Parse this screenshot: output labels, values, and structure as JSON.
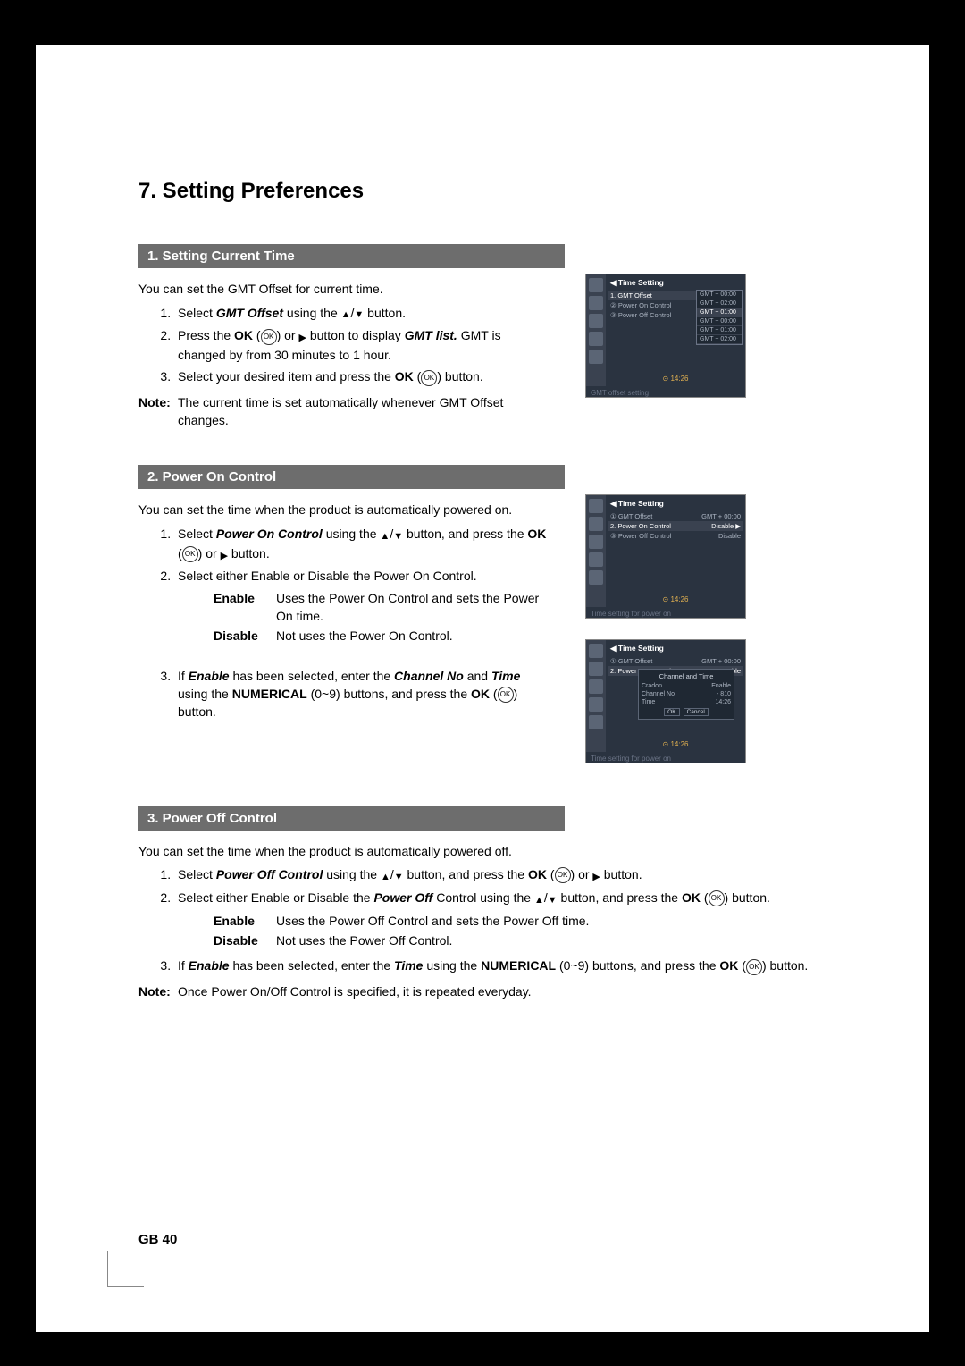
{
  "page": {
    "chapter_title": "7. Setting Preferences",
    "footer": "GB 40"
  },
  "s1": {
    "bar": "1. Setting Current Time",
    "intro": "You can set the GMT Offset for current time.",
    "step1_a": "Select ",
    "step1_b": "GMT Offset",
    "step1_c": " using the ",
    "step1_d": " button.",
    "step2_a": "Press the ",
    "step2_b": "OK",
    "step2_c": " button to display ",
    "step2_d": "GMT list.",
    "step2_e": " GMT is changed by from 30 minutes to 1 hour.",
    "step3_a": "Select your desired item and press the ",
    "step3_b": "OK",
    "step3_c": " button.",
    "note_label": "Note:",
    "note_body": "The current time is set automatically whenever GMT Offset changes."
  },
  "s2": {
    "bar": "2. Power On Control",
    "intro": "You can set the time when the product is automatically powered on.",
    "step1_a": "Select ",
    "step1_b": "Power On Control",
    "step1_c": " using the ",
    "step1_d": " button, and press the ",
    "step1_e": "OK",
    "step1_f": " button.",
    "step2": "Select either Enable or Disable the Power On Control.",
    "def_enable_t": "Enable",
    "def_enable_d": "Uses the Power On Control and sets the Power On time.",
    "def_disable_t": "Disable",
    "def_disable_d": "Not uses the Power On Control.",
    "step3_a": "If ",
    "step3_b": "Enable",
    "step3_c": " has been selected, enter the ",
    "step3_d": "Channel No",
    "step3_e": " and ",
    "step3_f": "Time",
    "step3_g": " using the ",
    "step3_h": "NUMERICAL",
    "step3_i": " (0~9) buttons, and press the ",
    "step3_j": "OK",
    "step3_k": " button."
  },
  "s3": {
    "bar": "3. Power Off Control",
    "intro": "You can set the time when the product is automatically powered off.",
    "step1_a": "Select ",
    "step1_b": "Power Off Control",
    "step1_c": " using the ",
    "step1_d": " button, and press the ",
    "step1_e": "OK",
    "step1_f": " button.",
    "step2_a": "Select either Enable or Disable the ",
    "step2_b": "Power Off",
    "step2_c": " Control using the ",
    "step2_d": " button, and press the ",
    "step2_e": "OK",
    "step2_f": " button.",
    "def_enable_t": "Enable",
    "def_enable_d": "Uses the Power Off Control and sets the Power Off time.",
    "def_disable_t": "Disable",
    "def_disable_d": "Not uses the Power Off Control.",
    "step3_a": "If ",
    "step3_b": "Enable",
    "step3_c": " has been selected, enter the ",
    "step3_d": "Time",
    "step3_e": " using the ",
    "step3_f": "NUMERICAL",
    "step3_g": " (0~9) buttons, and press the ",
    "step3_h": "OK",
    "step3_i": " button.",
    "note_label": "Note:",
    "note_body": "Once Power On/Off Control is specified, it is repeated everyday."
  },
  "shots": {
    "title": "Time Setting",
    "row_gmt": "GMT Offset",
    "row_pon": "Power On Control",
    "row_poff": "Power Off Control",
    "gmt_v": "GMT + 00:00",
    "dd1": "GMT + 00:00",
    "dd2": "GMT + 01:00",
    "dd3": "GMT + 01:00",
    "dd4": "GMT + 02:00",
    "dd5": "GMT + 02:00",
    "disable": "Disable",
    "disable_arrow": "Disable ▶",
    "enable": "Enable",
    "time": "14:26",
    "cap1": "GMT offset setting",
    "cap2": "Time setting for power on",
    "cap3": "Time setting for power on",
    "popup_title": "Channel and Time",
    "popup_cradon": "Cradon",
    "popup_cradon_v": "Enable",
    "popup_ch": "Channel No",
    "popup_ch_v": "- 810",
    "popup_time": "Time",
    "popup_time_v": "14:26",
    "popup_ok": "OK",
    "popup_cancel": "Cancel",
    "num1": "1.",
    "num2": "2.",
    "num3": "3.",
    "tri": "◀"
  }
}
